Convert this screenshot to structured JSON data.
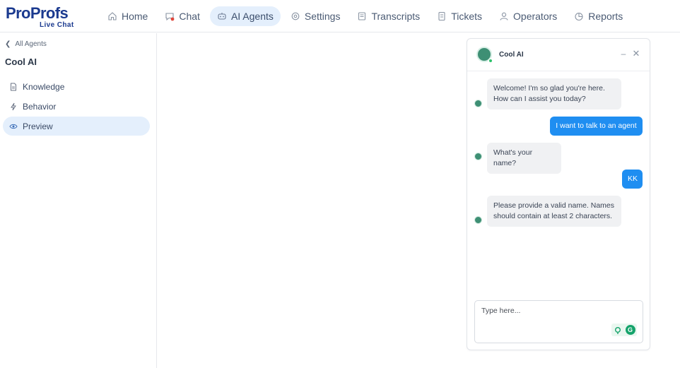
{
  "brand": {
    "logo_pro": "Pro",
    "logo_profs": "Profs",
    "logo_sub": "Live Chat"
  },
  "nav": {
    "items": [
      {
        "label": "Home",
        "icon": "home-icon"
      },
      {
        "label": "Chat",
        "icon": "chat-icon"
      },
      {
        "label": "AI Agents",
        "icon": "robot-icon",
        "active": true
      },
      {
        "label": "Settings",
        "icon": "gear-icon"
      },
      {
        "label": "Transcripts",
        "icon": "transcript-icon"
      },
      {
        "label": "Tickets",
        "icon": "ticket-icon"
      },
      {
        "label": "Operators",
        "icon": "user-icon"
      },
      {
        "label": "Reports",
        "icon": "pie-chart-icon"
      }
    ]
  },
  "sidebar": {
    "back_label": "All Agents",
    "agent_name": "Cool AI",
    "items": [
      {
        "label": "Knowledge",
        "icon": "document-icon"
      },
      {
        "label": "Behavior",
        "icon": "bolt-icon"
      },
      {
        "label": "Preview",
        "icon": "eye-icon",
        "active": true
      }
    ]
  },
  "chat": {
    "title": "Cool AI",
    "messages": [
      {
        "from": "bot",
        "text_line1": "Welcome! I'm so glad you're here.",
        "text_line2": "How can I assist you today?"
      },
      {
        "from": "user",
        "text": "I want to talk to an agent"
      },
      {
        "from": "bot",
        "text": "What's your name?"
      },
      {
        "from": "user",
        "text": "KK"
      },
      {
        "from": "bot",
        "text_line1": "Please provide a valid name. Names",
        "text_line2": "should contain at least 2 characters."
      }
    ],
    "input_placeholder": "Type here..."
  },
  "colors": {
    "brand_blue": "#1b3a8f",
    "accent_blue": "#1f8ef1",
    "active_bg": "#e4effc",
    "bot_avatar": "#3e8f74",
    "online": "#2dc26b",
    "chat_badge": "#e0463b"
  }
}
